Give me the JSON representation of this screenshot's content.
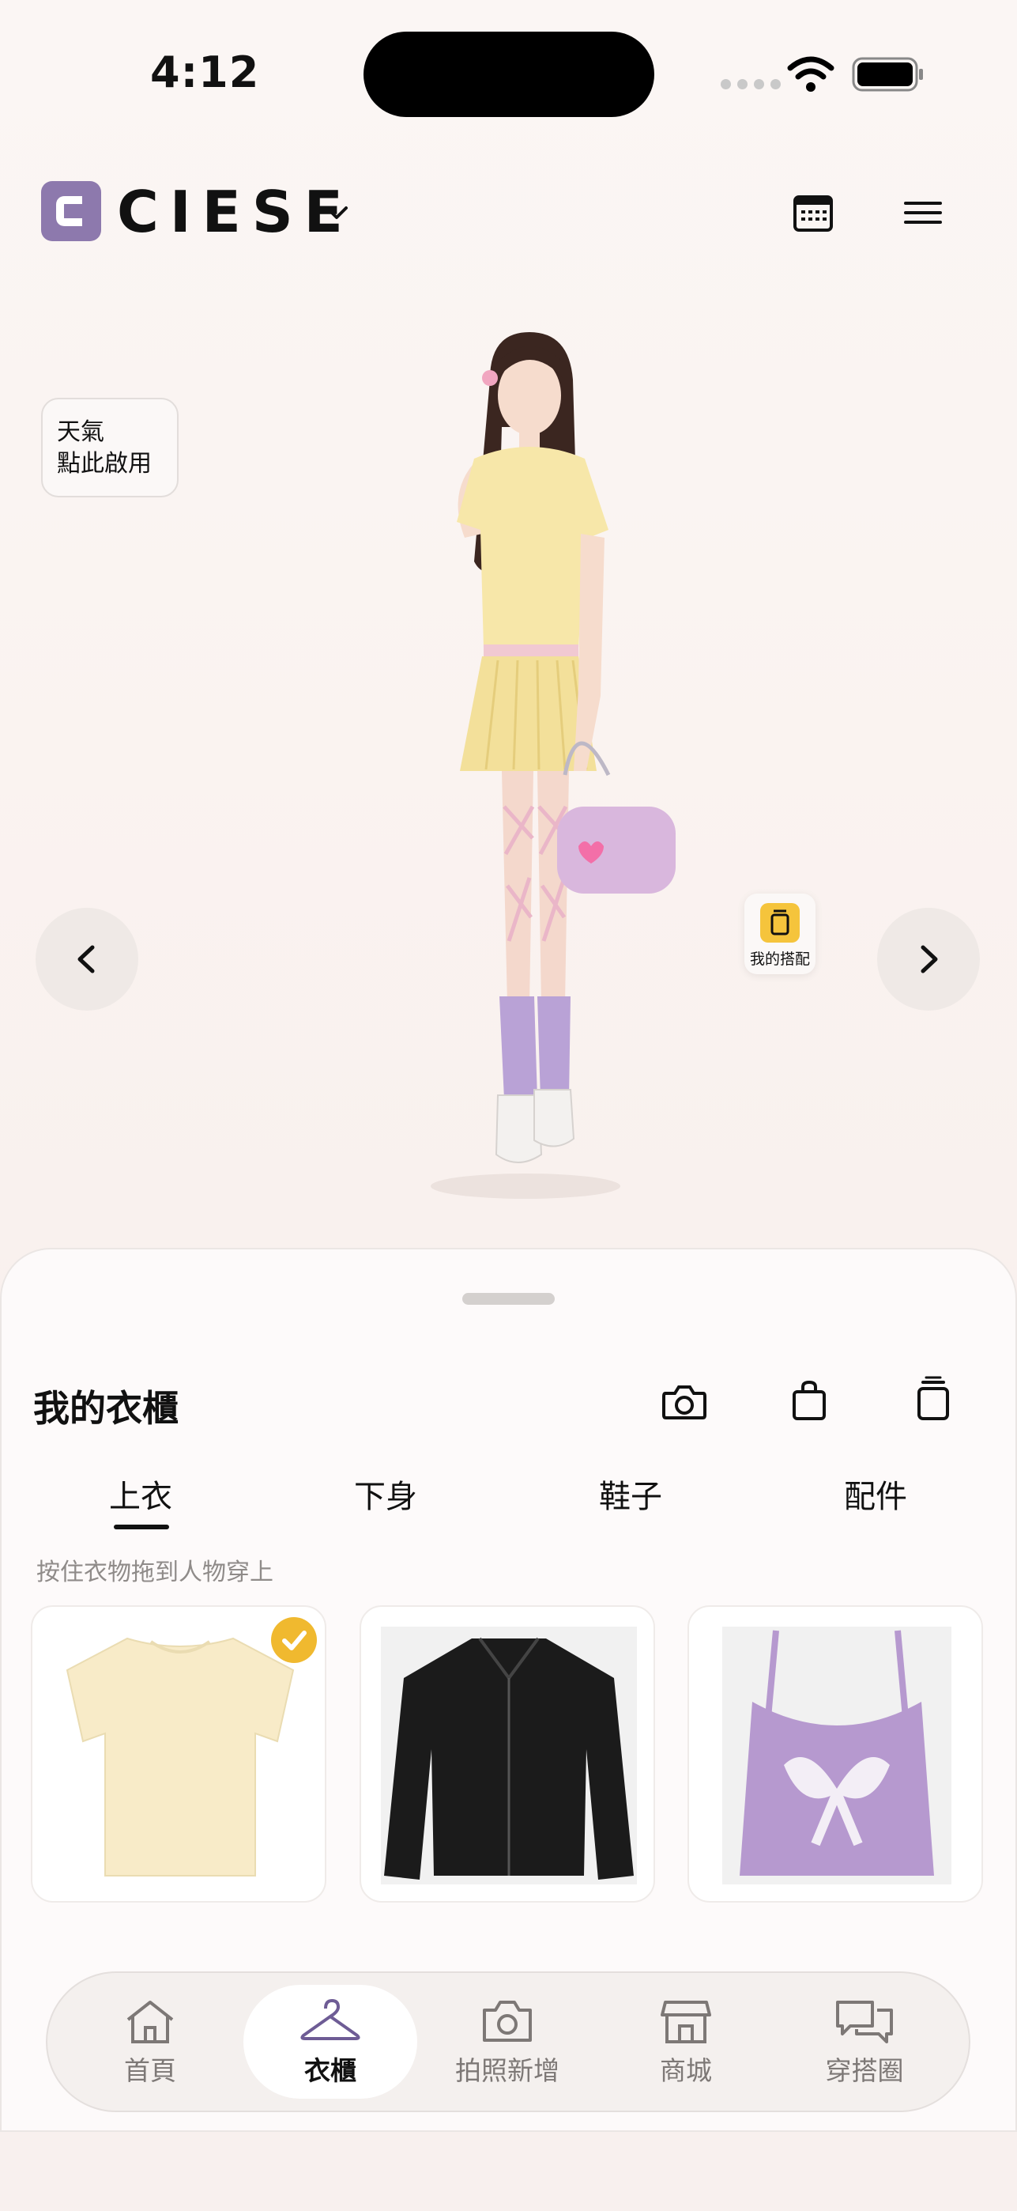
{
  "status_bar": {
    "time": "4:12"
  },
  "header": {
    "brand": "CIESE"
  },
  "weather": {
    "line1": "天氣",
    "line2": "點此啟用"
  },
  "outfit_shortcut": {
    "label": "我的搭配"
  },
  "wardrobe": {
    "title": "我的衣櫃",
    "tabs": [
      "上衣",
      "下身",
      "鞋子",
      "配件"
    ],
    "active_tab_index": 0,
    "hint": "按住衣物拖到人物穿上",
    "items": [
      {
        "name": "cream-tshirt",
        "color": "#f8ebc8",
        "selected": true
      },
      {
        "name": "black-jacket",
        "color": "#1b1b1b",
        "selected": false
      },
      {
        "name": "purple-bow-camisole",
        "color": "#b699cf",
        "selected": false
      }
    ]
  },
  "tabbar": {
    "items": [
      {
        "label": "首頁",
        "icon": "home-icon"
      },
      {
        "label": "衣櫃",
        "icon": "hanger-icon"
      },
      {
        "label": "拍照新增",
        "icon": "camera-icon"
      },
      {
        "label": "商城",
        "icon": "store-icon"
      },
      {
        "label": "穿搭圈",
        "icon": "chat-bubbles-icon"
      }
    ],
    "active_index": 1
  },
  "colors": {
    "brand": "#8d79ad",
    "accent_yellow": "#f0b92f",
    "outfit_icon": "#f5c43c"
  }
}
